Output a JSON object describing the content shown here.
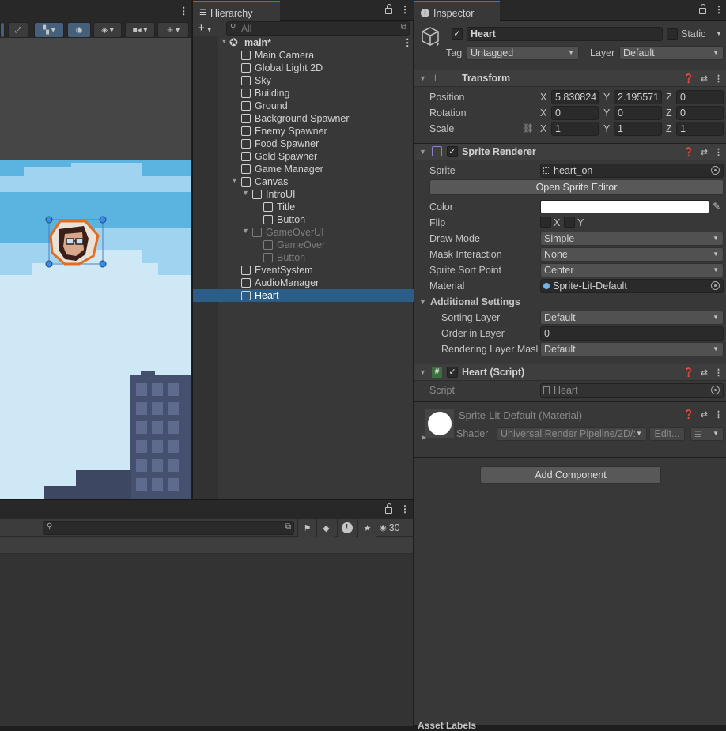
{
  "scene": {
    "toolbar_kebab": "⋮"
  },
  "hierarchy": {
    "tab_label": "Hierarchy",
    "search_placeholder": "All",
    "add_label": "+",
    "root": "main*",
    "items": [
      {
        "label": "Main Camera"
      },
      {
        "label": "Global Light 2D"
      },
      {
        "label": "Sky"
      },
      {
        "label": "Building"
      },
      {
        "label": "Ground"
      },
      {
        "label": "Background Spawner"
      },
      {
        "label": "Enemy Spawner"
      },
      {
        "label": "Food Spawner"
      },
      {
        "label": "Gold Spawner"
      },
      {
        "label": "Game Manager"
      },
      {
        "label": "Canvas"
      },
      {
        "label": "IntroUI"
      },
      {
        "label": "Title"
      },
      {
        "label": "Button"
      },
      {
        "label": "GameOverUI"
      },
      {
        "label": "GameOver"
      },
      {
        "label": "Button"
      },
      {
        "label": "EventSystem"
      },
      {
        "label": "AudioManager"
      },
      {
        "label": "Heart"
      }
    ]
  },
  "console": {
    "count_label": "30"
  },
  "inspector": {
    "tab_label": "Inspector",
    "object_name": "Heart",
    "static_label": "Static",
    "tag_label": "Tag",
    "tag_value": "Untagged",
    "layer_label": "Layer",
    "layer_value": "Default",
    "transform": {
      "title": "Transform",
      "position_label": "Position",
      "rotation_label": "Rotation",
      "scale_label": "Scale",
      "position": {
        "x": "5.830824",
        "y": "2.195571",
        "z": "0"
      },
      "rotation": {
        "x": "0",
        "y": "0",
        "z": "0"
      },
      "scale": {
        "x": "1",
        "y": "1",
        "z": "1"
      },
      "axis_x": "X",
      "axis_y": "Y",
      "axis_z": "Z"
    },
    "sprite_renderer": {
      "title": "Sprite Renderer",
      "sprite_label": "Sprite",
      "sprite_value": "heart_on",
      "open_editor_label": "Open Sprite Editor",
      "color_label": "Color",
      "flip_label": "Flip",
      "flip_x": "X",
      "flip_y": "Y",
      "draw_mode_label": "Draw Mode",
      "draw_mode_value": "Simple",
      "mask_label": "Mask Interaction",
      "mask_value": "None",
      "sort_point_label": "Sprite Sort Point",
      "sort_point_value": "Center",
      "material_label": "Material",
      "material_value": "Sprite-Lit-Default",
      "additional_label": "Additional Settings",
      "sorting_layer_label": "Sorting Layer",
      "sorting_layer_value": "Default",
      "order_label": "Order in Layer",
      "order_value": "0",
      "rendering_layer_label": "Rendering Layer Masl",
      "rendering_layer_value": "Default"
    },
    "heart_script": {
      "title": "Heart (Script)",
      "script_label": "Script",
      "script_value": "Heart"
    },
    "material": {
      "title": "Sprite-Lit-Default (Material)",
      "shader_label": "Shader",
      "shader_value": "Universal Render Pipeline/2D/:",
      "edit_label": "Edit..."
    },
    "add_component_label": "Add Component",
    "asset_labels": "Asset Labels"
  },
  "colors": {
    "accent": "#3a79bb",
    "selection": "#2c5d87",
    "panel": "#383838"
  }
}
